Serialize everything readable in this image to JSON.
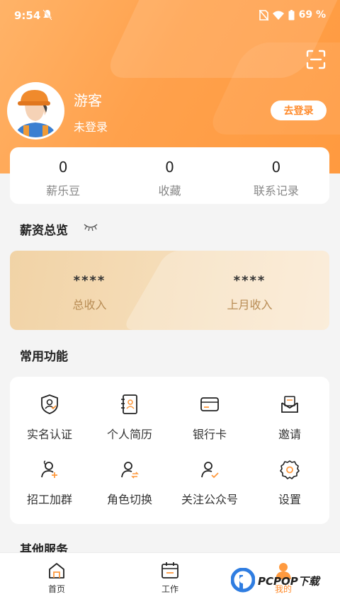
{
  "status_bar": {
    "time": "9:54",
    "battery": "69 %"
  },
  "profile": {
    "name": "游客",
    "status": "未登录",
    "login_button": "去登录"
  },
  "stats": [
    {
      "value": "0",
      "label": "薪乐豆"
    },
    {
      "value": "0",
      "label": "收藏"
    },
    {
      "value": "0",
      "label": "联系记录"
    }
  ],
  "salary": {
    "title": "薪资总览",
    "total_value": "****",
    "total_label": "总收入",
    "last_value": "****",
    "last_label": "上月收入"
  },
  "functions": {
    "title": "常用功能",
    "items": [
      {
        "label": "实名认证",
        "icon": "id-verify-icon"
      },
      {
        "label": "个人简历",
        "icon": "resume-icon"
      },
      {
        "label": "银行卡",
        "icon": "bank-card-icon"
      },
      {
        "label": "邀请",
        "icon": "invite-icon"
      },
      {
        "label": "招工加群",
        "icon": "add-group-icon"
      },
      {
        "label": "角色切换",
        "icon": "switch-role-icon"
      },
      {
        "label": "关注公众号",
        "icon": "follow-account-icon"
      },
      {
        "label": "设置",
        "icon": "settings-icon"
      }
    ]
  },
  "other_services": {
    "title": "其他服务"
  },
  "tabs": [
    {
      "label": "首页",
      "icon": "home-icon"
    },
    {
      "label": "工作",
      "icon": "calendar-icon"
    },
    {
      "label": "我的",
      "icon": "profile-icon"
    }
  ],
  "watermark": {
    "text": "PCPOP下载"
  },
  "colors": {
    "accent": "#ff9a3f",
    "gold": "#b88c54"
  }
}
